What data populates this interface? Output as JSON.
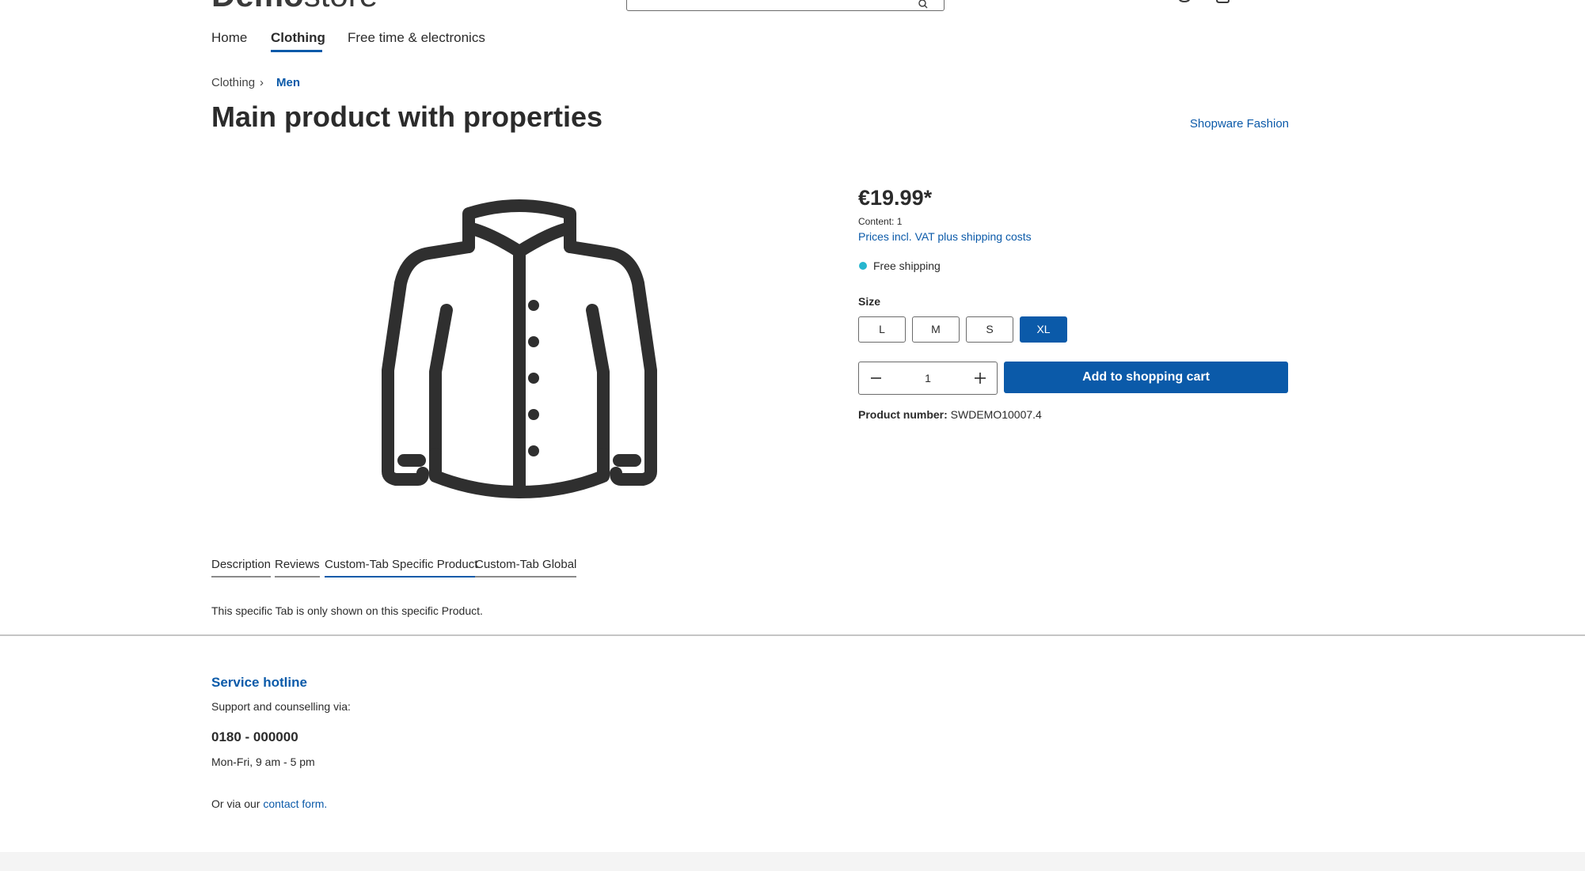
{
  "header": {
    "logo_bold": "Demo",
    "logo_light": "store"
  },
  "nav": {
    "items": [
      {
        "label": "Home"
      },
      {
        "label": "Clothing"
      },
      {
        "label": "Free time & electronics"
      }
    ],
    "active": "Clothing"
  },
  "breadcrumb": {
    "items": [
      "Clothing",
      "Men"
    ],
    "separator": "›"
  },
  "product": {
    "title": "Main product with properties",
    "manufacturer": "Shopware Fashion",
    "image_icon": "jacket-icon",
    "price": "€19.99*",
    "content": "Content: 1",
    "vat_text": "Prices incl. VAT plus shipping costs",
    "shipping": "Free shipping",
    "size_label": "Size",
    "sizes": [
      "L",
      "M",
      "S",
      "XL"
    ],
    "selected_size": "XL",
    "quantity": "1",
    "add_to_cart": "Add to shopping cart",
    "number_label": "Product number:",
    "number_value": "SWDEMO10007.4"
  },
  "tabs": {
    "items": [
      "Description",
      "Reviews",
      "Custom-Tab Specific Product",
      "Custom-Tab Global"
    ],
    "active": "Custom-Tab Specific Product",
    "content": "This specific Tab is only shown on this specific Product."
  },
  "footer": {
    "service_title": "Service hotline",
    "service_sub": "Support and counselling via:",
    "phone": "0180 - 000000",
    "hours": "Mon-Fri, 9 am - 5 pm",
    "contact_prefix": "Or via our ",
    "contact_link": "contact form."
  },
  "colors": {
    "accent": "#0b5aa9",
    "shipping_dot": "#26b6cf",
    "text": "#2b2b2b"
  }
}
